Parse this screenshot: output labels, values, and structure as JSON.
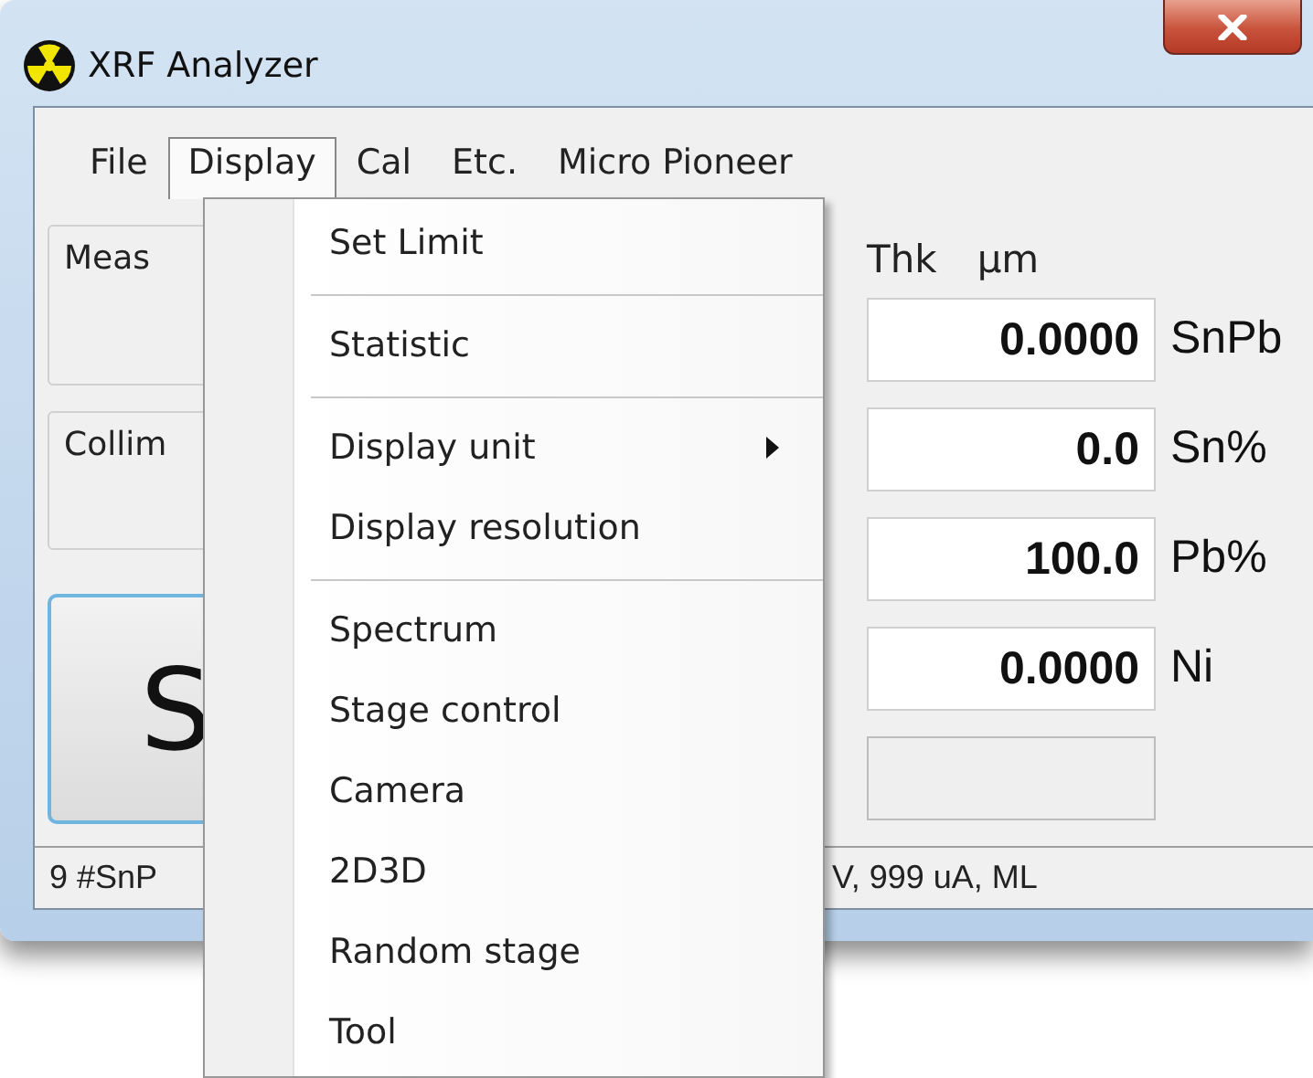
{
  "window": {
    "title": "XRF Analyzer"
  },
  "menu_bar": [
    {
      "label": "File",
      "selected": false
    },
    {
      "label": "Display",
      "selected": true
    },
    {
      "label": "Cal",
      "selected": false
    },
    {
      "label": "Etc.",
      "selected": false
    },
    {
      "label": "Micro Pioneer",
      "selected": false
    }
  ],
  "dropdown": [
    {
      "kind": "item",
      "label": "Set Limit"
    },
    {
      "kind": "separator"
    },
    {
      "kind": "item",
      "label": "Statistic"
    },
    {
      "kind": "separator"
    },
    {
      "kind": "submenu",
      "label": "Display unit"
    },
    {
      "kind": "item",
      "label": "Display resolution"
    },
    {
      "kind": "separator"
    },
    {
      "kind": "item",
      "label": "Spectrum"
    },
    {
      "kind": "item",
      "label": "Stage control"
    },
    {
      "kind": "item",
      "label": "Camera"
    },
    {
      "kind": "item",
      "label": "2D3D"
    },
    {
      "kind": "item",
      "label": "Random stage"
    },
    {
      "kind": "item",
      "label": "Tool"
    }
  ],
  "left_panel": {
    "groups": [
      "Meas",
      "Collim"
    ],
    "start_button": "S"
  },
  "thickness_header": {
    "label": "Thk",
    "unit": "µm"
  },
  "results": [
    {
      "value": "0.0000",
      "unit": "SnPb",
      "disabled": false
    },
    {
      "value": "0.0",
      "unit": "Sn%",
      "disabled": false
    },
    {
      "value": "100.0",
      "unit": "Pb%",
      "disabled": false
    },
    {
      "value": "0.0000",
      "unit": "Ni",
      "disabled": false
    },
    {
      "disabled": true
    }
  ],
  "status_bar": [
    "9 #SnP",
    "V, 999 uA, ML"
  ]
}
